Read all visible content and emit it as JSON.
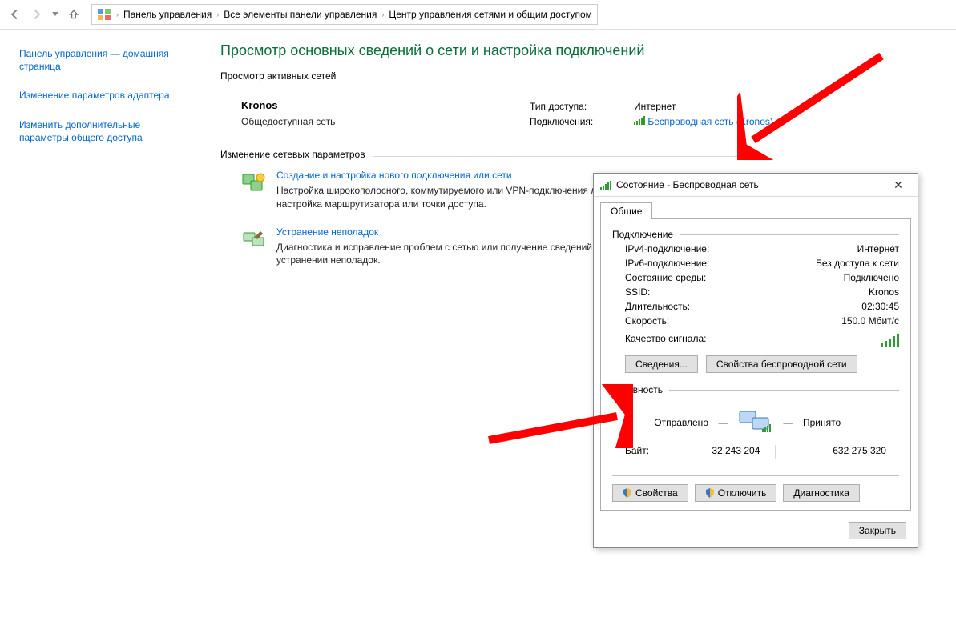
{
  "breadcrumb": {
    "root": "Панель управления",
    "mid": "Все элементы панели управления",
    "leaf": "Центр управления сетями и общим доступом"
  },
  "sidebar": {
    "home": "Панель управления — домашняя страница",
    "adapter": "Изменение параметров адаптера",
    "advanced": "Изменить дополнительные параметры общего доступа"
  },
  "page": {
    "title": "Просмотр основных сведений о сети и настройка подключений",
    "active_head": "Просмотр активных сетей",
    "change_head": "Изменение сетевых параметров"
  },
  "network": {
    "name": "Kronos",
    "type": "Общедоступная сеть",
    "access_lbl": "Тип доступа:",
    "access_val": "Интернет",
    "conn_lbl": "Подключения:",
    "conn_val": "Беспроводная сеть (Kronos)"
  },
  "tasks": {
    "create_title": "Создание и настройка нового подключения или сети",
    "create_desc": "Настройка широкополосного, коммутируемого или VPN-подключения либо настройка маршрутизатора или точки доступа.",
    "diag_title": "Устранение неполадок",
    "diag_desc": "Диагностика и исправление проблем с сетью или получение сведений об устранении неполадок."
  },
  "dlg": {
    "title": "Состояние - Беспроводная сеть",
    "tab": "Общие",
    "grp_conn": "Подключение",
    "ipv4_lbl": "IPv4-подключение:",
    "ipv4_val": "Интернет",
    "ipv6_lbl": "IPv6-подключение:",
    "ipv6_val": "Без доступа к сети",
    "media_lbl": "Состояние среды:",
    "media_val": "Подключено",
    "ssid_lbl": "SSID:",
    "ssid_val": "Kronos",
    "dur_lbl": "Длительность:",
    "dur_val": "02:30:45",
    "speed_lbl": "Скорость:",
    "speed_val": "150.0 Мбит/с",
    "sig_lbl": "Качество сигнала:",
    "details_btn": "Сведения...",
    "wprops_btn": "Свойства беспроводной сети",
    "grp_act": "Активность",
    "sent_lbl": "Отправлено",
    "recv_lbl": "Принято",
    "bytes_lbl": "Байт:",
    "bytes_sent": "32 243 204",
    "bytes_recv": "632 275 320",
    "props_btn": "Свойства",
    "disc_btn": "Отключить",
    "diag_btn": "Диагностика",
    "close_btn": "Закрыть"
  }
}
